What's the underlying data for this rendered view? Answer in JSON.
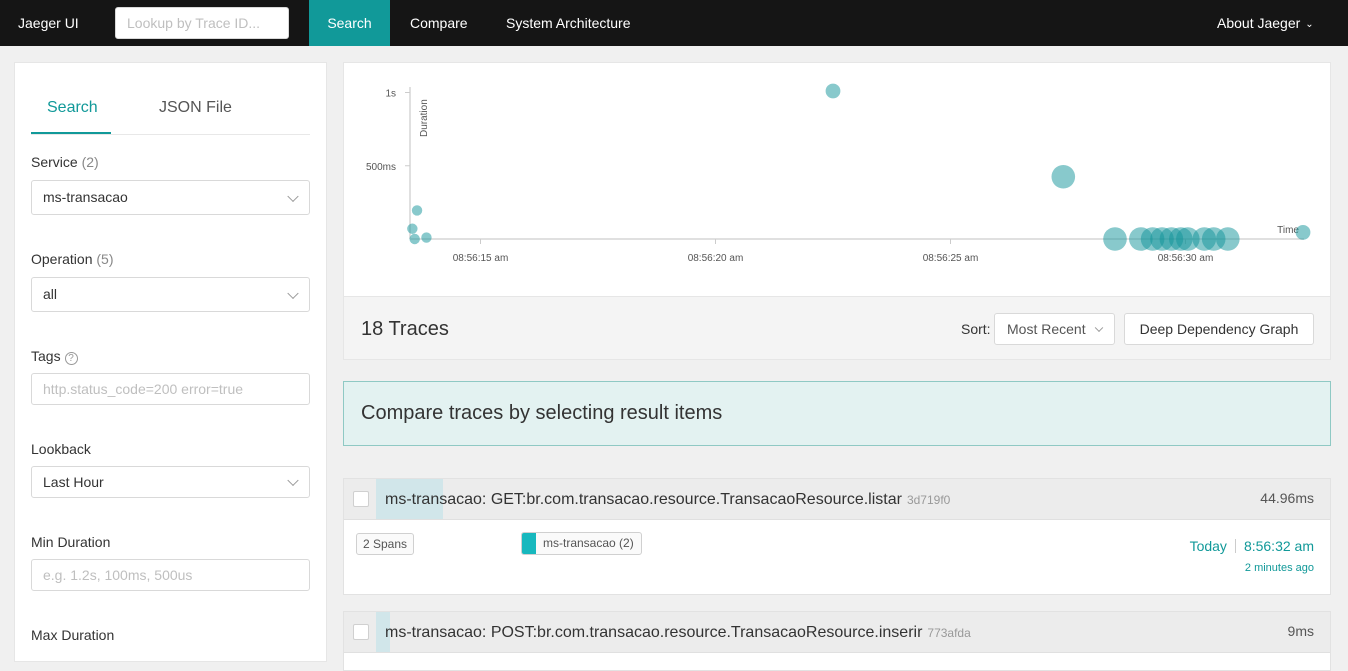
{
  "nav": {
    "brand": "Jaeger UI",
    "lookup_placeholder": "Lookup by Trace ID...",
    "search": "Search",
    "compare": "Compare",
    "system_architecture": "System Architecture",
    "about": "About Jaeger"
  },
  "sidebar": {
    "tabs": {
      "search": "Search",
      "json_file": "JSON File"
    },
    "service": {
      "label": "Service",
      "count": "(2)",
      "value": "ms-transacao"
    },
    "operation": {
      "label": "Operation",
      "count": "(5)",
      "value": "all"
    },
    "tags": {
      "label": "Tags",
      "help": "?",
      "placeholder": "http.status_code=200 error=true"
    },
    "lookback": {
      "label": "Lookback",
      "value": "Last Hour"
    },
    "min_duration": {
      "label": "Min Duration",
      "placeholder": "e.g. 1.2s, 100ms, 500us"
    },
    "max_duration": {
      "label": "Max Duration"
    }
  },
  "chart_data": {
    "type": "scatter",
    "ylabel": "Duration",
    "xlabel": "Time",
    "y_ticks": [
      "1s",
      "500ms"
    ],
    "y_tick_values_ms": [
      1000,
      500
    ],
    "x_ticks": [
      "08:56:15 am",
      "08:56:20 am",
      "08:56:25 am",
      "08:56:30 am"
    ],
    "x_tick_values_s": [
      15,
      20,
      25,
      30
    ],
    "points": [
      {
        "t": 13.55,
        "ms": 70,
        "spans": 1
      },
      {
        "t": 13.65,
        "ms": 195,
        "spans": 1
      },
      {
        "t": 13.6,
        "ms": 0,
        "spans": 1
      },
      {
        "t": 13.85,
        "ms": 10,
        "spans": 1
      },
      {
        "t": 22.5,
        "ms": 1010,
        "spans": 2
      },
      {
        "t": 27.4,
        "ms": 425,
        "spans": 4
      },
      {
        "t": 28.5,
        "ms": 0,
        "spans": 4
      },
      {
        "t": 29.05,
        "ms": 0,
        "spans": 4
      },
      {
        "t": 29.3,
        "ms": 0,
        "spans": 4
      },
      {
        "t": 29.5,
        "ms": 0,
        "spans": 4
      },
      {
        "t": 29.7,
        "ms": 0,
        "spans": 4
      },
      {
        "t": 29.9,
        "ms": 0,
        "spans": 4
      },
      {
        "t": 30.05,
        "ms": 0,
        "spans": 4
      },
      {
        "t": 30.4,
        "ms": 0,
        "spans": 4
      },
      {
        "t": 30.6,
        "ms": 0,
        "spans": 4
      },
      {
        "t": 30.9,
        "ms": 0,
        "spans": 4
      },
      {
        "t": 32.5,
        "ms": 45,
        "spans": 2
      }
    ]
  },
  "results": {
    "count": "18 Traces",
    "sort_label": "Sort:",
    "sort_value": "Most Recent",
    "ddg_button": "Deep Dependency Graph",
    "compare_banner": "Compare traces by selecting result items"
  },
  "traces": [
    {
      "title": "ms-transacao: GET:br.com.transacao.resource.TransacaoResource.listar",
      "id": "3d719f0",
      "duration": "44.96ms",
      "duration_fraction": 0.07,
      "spans": "2 Spans",
      "service": "ms-transacao (2)",
      "service_color": "#17b8be",
      "date": "Today",
      "time": "8:56:32 am",
      "ago": "2 minutes ago"
    },
    {
      "title": "ms-transacao: POST:br.com.transacao.resource.TransacaoResource.inserir",
      "id": "773afda",
      "duration": "9ms",
      "duration_fraction": 0.015
    }
  ]
}
